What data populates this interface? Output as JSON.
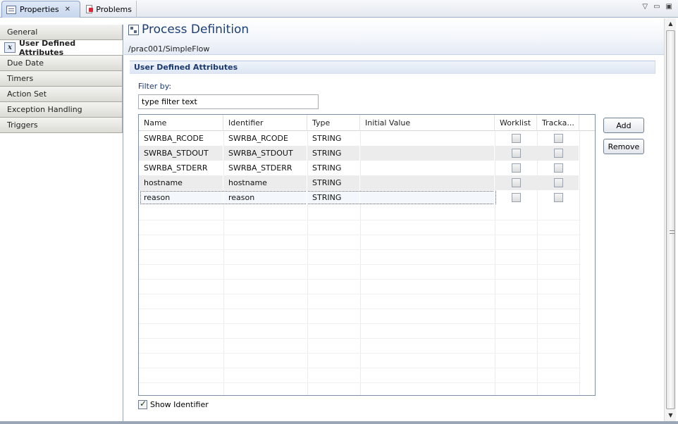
{
  "tabs": {
    "properties": "Properties",
    "problems": "Problems",
    "close_glyph": "✕"
  },
  "window_controls": [
    "▽",
    "▭",
    "▣"
  ],
  "sidebar": {
    "items": [
      {
        "label": "General"
      },
      {
        "label": "User Defined Attributes",
        "active": true
      },
      {
        "label": "Due Date"
      },
      {
        "label": "Timers"
      },
      {
        "label": "Action Set"
      },
      {
        "label": "Exception Handling"
      },
      {
        "label": "Triggers"
      }
    ],
    "active_icon_glyph": "x"
  },
  "header": {
    "title": "Process Definition",
    "path": "/prac001/SimpleFlow"
  },
  "section": {
    "title": "User Defined Attributes"
  },
  "filter": {
    "label": "Filter by:",
    "value": "type filter text"
  },
  "table": {
    "columns": [
      "Name",
      "Identifier",
      "Type",
      "Initial Value",
      "Worklist",
      "Tracka..."
    ],
    "rows": [
      {
        "name": "SWRBA_RCODE",
        "identifier": "SWRBA_RCODE",
        "type": "STRING",
        "initial_value": "",
        "worklist": false,
        "trackable": false
      },
      {
        "name": "SWRBA_STDOUT",
        "identifier": "SWRBA_STDOUT",
        "type": "STRING",
        "initial_value": "",
        "worklist": false,
        "trackable": false
      },
      {
        "name": "SWRBA_STDERR",
        "identifier": "SWRBA_STDERR",
        "type": "STRING",
        "initial_value": "",
        "worklist": false,
        "trackable": false
      },
      {
        "name": "hostname",
        "identifier": "hostname",
        "type": "STRING",
        "initial_value": "",
        "worklist": false,
        "trackable": false
      },
      {
        "name": "reason",
        "identifier": "reason",
        "type": "STRING",
        "initial_value": "",
        "worklist": false,
        "trackable": false,
        "selected": true
      }
    ]
  },
  "buttons": {
    "add": "Add",
    "remove": "Remove"
  },
  "show_identifier": {
    "label": "Show Identifier",
    "checked": true
  }
}
